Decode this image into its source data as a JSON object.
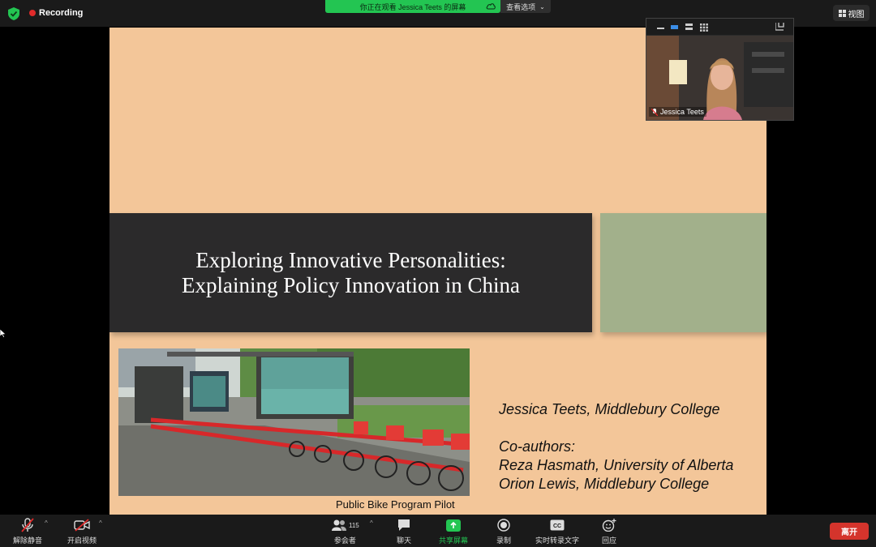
{
  "topbar": {
    "recording_label": "Recording",
    "viewing_banner": "你正在观看 Jessica Teets 的屏幕",
    "view_options_label": "查看选项",
    "view_label": "视图",
    "icons": [
      "shield-icon",
      "record-dot-icon",
      "cloud-icon",
      "chevron-down-icon",
      "grid-icon"
    ]
  },
  "slide": {
    "title_line1": "Exploring Innovative Personalities:",
    "title_line2": "Explaining Policy Innovation in China",
    "photo_caption": "Public Bike Program Pilot",
    "author_line": "Jessica Teets, Middlebury College",
    "coauthors_heading": "Co-authors:",
    "coauthor1": "Reza Hasmath, University of Alberta",
    "coauthor2": "Orion Lewis, Middlebury College",
    "colors": {
      "background": "#f3c699",
      "title_band": "#2b2a2b",
      "green_block": "#a2b08b"
    }
  },
  "video": {
    "participant_name": "Jessica Teets",
    "icons": [
      "minimize-icon",
      "speaker-view-icon",
      "strip-view-icon",
      "gallery-icon",
      "exit-fullscreen-icon",
      "muted-mic-icon"
    ]
  },
  "toolbar": {
    "unmute_label": "解除静音",
    "start_video_label": "开启视频",
    "participants_label": "参会者",
    "participants_count": "115",
    "chat_label": "聊天",
    "share_label": "共享屏幕",
    "record_label": "录制",
    "captions_label": "实时转录文字",
    "captions_badge": "CC",
    "reactions_label": "回应",
    "leave_label": "离开",
    "accent_green": "#23c552",
    "leave_color": "#d4342c"
  }
}
